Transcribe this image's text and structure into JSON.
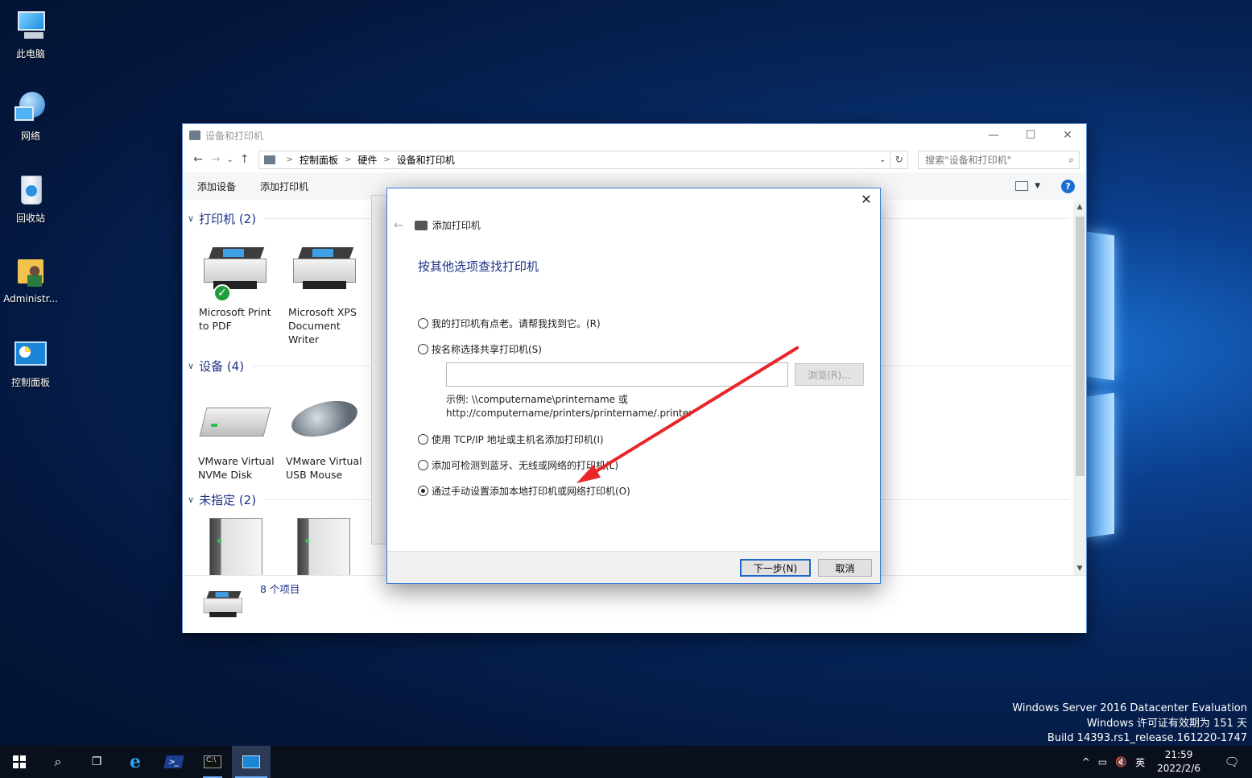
{
  "desktop": {
    "icons": [
      {
        "label": "此电脑",
        "icon": "computer-icon"
      },
      {
        "label": "网络",
        "icon": "network-icon"
      },
      {
        "label": "回收站",
        "icon": "recycle-bin-icon"
      },
      {
        "label": "Administr...",
        "icon": "user-folder-icon"
      },
      {
        "label": "控制面板",
        "icon": "control-panel-icon"
      }
    ],
    "watermark": {
      "line1": "Windows Server 2016 Datacenter Evaluation",
      "line2": "Windows 许可证有效期为 151 天",
      "line3": "Build 14393.rs1_release.161220-1747"
    }
  },
  "explorer": {
    "title": "设备和打印机",
    "window_controls": {
      "minimize": "—",
      "maximize": "☐",
      "close": "✕"
    },
    "nav": {
      "back": "←",
      "forward": "→",
      "recent": "⌄",
      "up": "↑"
    },
    "breadcrumb": [
      "控制面板",
      "硬件",
      "设备和打印机"
    ],
    "search_placeholder": "搜索\"设备和打印机\"",
    "commands": [
      "添加设备",
      "添加打印机"
    ],
    "groups": [
      {
        "name": "打印机 (2)",
        "devices": [
          {
            "label": "Microsoft Print to PDF",
            "icon": "printer-icon",
            "default": true
          },
          {
            "label": "Microsoft XPS Document Writer",
            "icon": "printer-icon"
          }
        ]
      },
      {
        "name": "设备 (4)",
        "devices": [
          {
            "label": "VMware Virtual NVMe Disk",
            "icon": "disk-icon"
          },
          {
            "label": "VMware Virtual USB Mouse",
            "icon": "mouse-icon"
          }
        ]
      },
      {
        "name": "未指定 (2)",
        "devices": [
          {
            "label": "",
            "icon": "tower-server-icon"
          },
          {
            "label": "",
            "icon": "tower-server-icon"
          }
        ]
      }
    ],
    "item_count": "8 个项目"
  },
  "dialog": {
    "title": "添加打印机",
    "heading": "按其他选项查找打印机",
    "options": [
      {
        "label": "我的打印机有点老。请帮我找到它。(R)",
        "selected": false
      },
      {
        "label": "按名称选择共享打印机(S)",
        "selected": false
      },
      {
        "label": "使用 TCP/IP 地址或主机名添加打印机(I)",
        "selected": false
      },
      {
        "label": "添加可检测到蓝牙、无线或网络的打印机(L)",
        "selected": false
      },
      {
        "label": "通过手动设置添加本地打印机或网络打印机(O)",
        "selected": true
      }
    ],
    "share_input_value": "",
    "browse_label": "浏览(R)...",
    "example_line1": "示例: \\\\computername\\printername 或",
    "example_line2": "http://computername/printers/printername/.printer",
    "next_label": "下一步(N)",
    "cancel_label": "取消",
    "close_glyph": "✕"
  },
  "annotation": {
    "color": "#e8262a"
  },
  "taskbar": {
    "tray": {
      "chevron": "^",
      "ime": "英",
      "time": "21:59",
      "date": "2022/2/6"
    }
  }
}
